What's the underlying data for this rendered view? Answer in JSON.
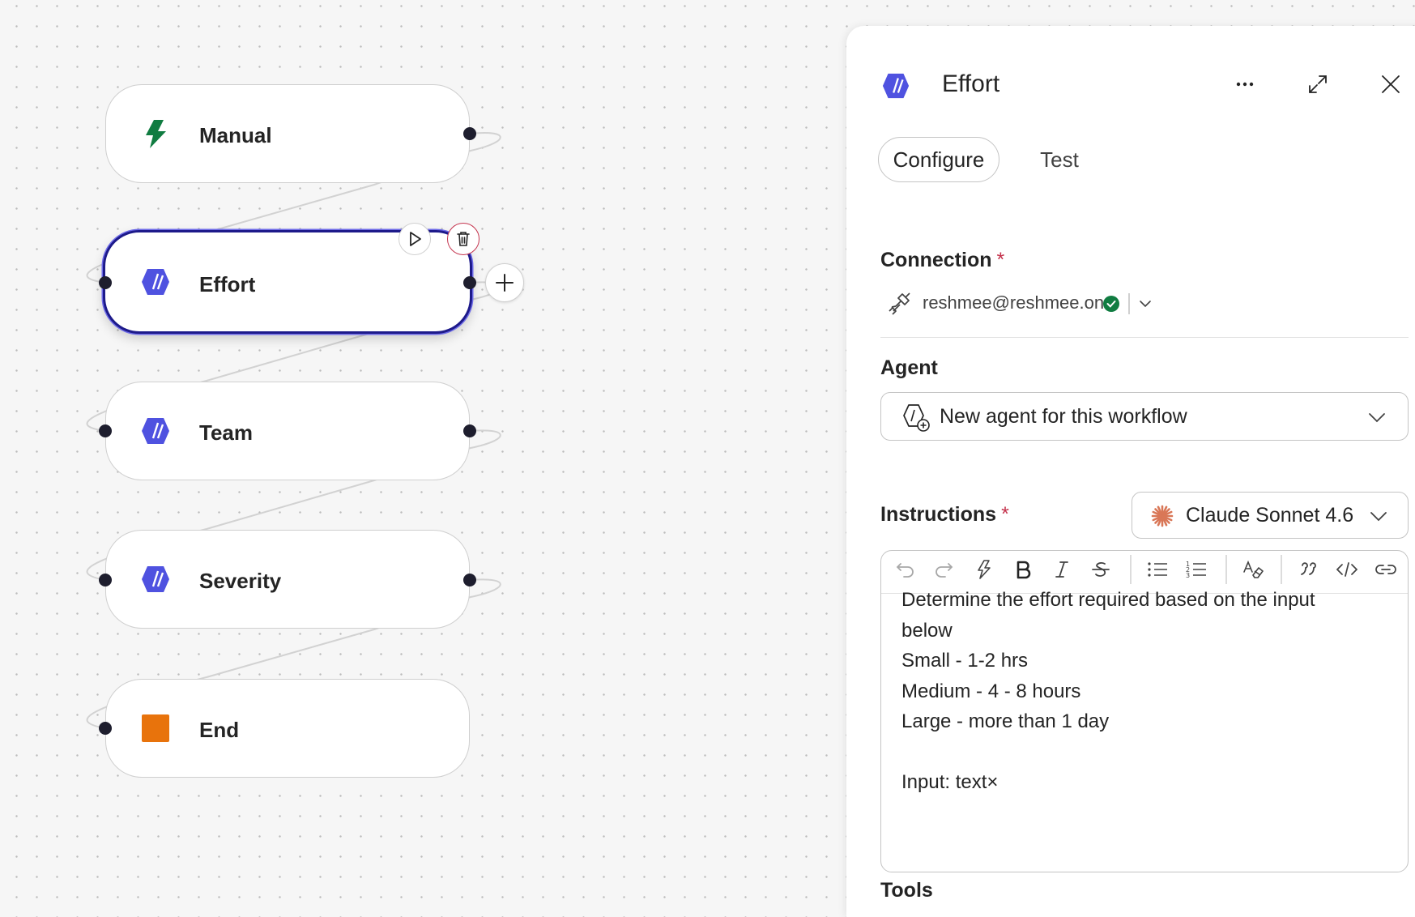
{
  "canvas": {
    "nodes": [
      {
        "label": "Manual",
        "icon": "lightning-icon"
      },
      {
        "label": "Effort",
        "icon": "agent-icon",
        "selected": true
      },
      {
        "label": "Team",
        "icon": "agent-icon"
      },
      {
        "label": "Severity",
        "icon": "agent-icon"
      },
      {
        "label": "End",
        "icon": "stop-square-icon"
      }
    ]
  },
  "panel": {
    "title": "Effort",
    "tabs": {
      "configure": "Configure",
      "test": "Test"
    },
    "connection": {
      "label": "Connection",
      "required_mark": "*",
      "value": "reshmee@reshmee.on...",
      "status": "connected"
    },
    "agent": {
      "label": "Agent",
      "value": "New agent for this workflow"
    },
    "instructions": {
      "label": "Instructions",
      "required_mark": "*",
      "model": "Claude Sonnet 4.6",
      "lines": [
        "Determine the effort required based on the input",
        "below",
        "Small - 1-2 hrs",
        "Medium - 4 - 8 hours",
        "Large - more than 1 day",
        "",
        "Input: text×"
      ]
    },
    "tools": {
      "label": "Tools"
    }
  },
  "colors": {
    "accent": "#1d1a8a",
    "agent_icon": "#4f52e0",
    "trigger_icon": "#107c41",
    "end_icon": "#e8730c",
    "danger": "#c5354f",
    "success": "#107c41",
    "claude": "#d97757"
  }
}
